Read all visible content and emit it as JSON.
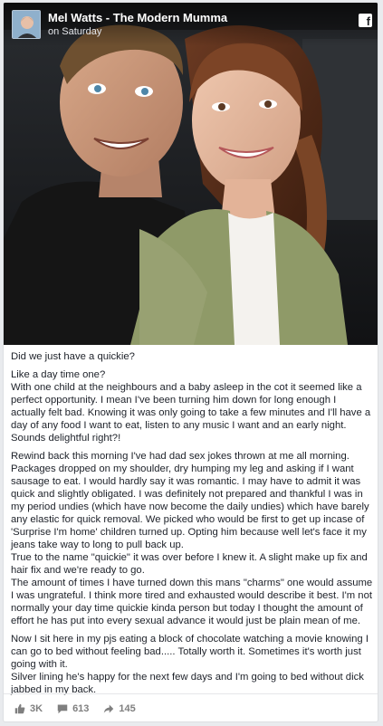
{
  "header": {
    "page_name": "Mel Watts - The Modern Mumma",
    "time": "on Saturday",
    "facebook_glyph": "f"
  },
  "post": {
    "paragraphs": [
      "Did we just have a quickie?",
      "Like a day time one?\nWith one child at the neighbours and a baby asleep in the cot it seemed like a perfect opportunity. I mean I've been turning him down for long enough I actually felt bad. Knowing it was only going to take a few minutes and I'll have a day of any food I want to eat, listen to any music I want and an early night. Sounds delightful right?!",
      "Rewind back this morning I've had dad sex jokes thrown at me all morning. Packages dropped on my shoulder, dry humping my leg and asking if I want sausage to eat. I would hardly say it was romantic. I may have to admit it was quick and slightly obligated. I was definitely not prepared and thankful I was in my period undies (which have now become the daily undies) which have barely any elastic for quick removal. We picked who would be first to get up incase of 'Surprise I'm home' children turned up. Opting him because well let's face it my jeans take way to long to pull back up.\nTrue to the name \"quickie\" it was over before I knew it. A slight make up fix and hair fix and we're ready to go.\nThe amount of times I have turned down this mans \"charms\" one would assume I was ungrateful. I think more tired and exhausted would describe it best. I'm not normally your day time quickie kinda person but today I thought the amount of effort he has put into every sexual advance it would just be plain mean of me.",
      "Now I sit here in my pjs eating a block of chocolate watching a movie knowing I can go to bed without feeling bad..... Totally worth it. Sometimes it's worth just going with it.\nSilver lining he's happy for the next few days and I'm going to bed without dick jabbed in my back."
    ]
  },
  "footer": {
    "likes": "3K",
    "comments": "613",
    "shares": "145",
    "icons": [
      "thumbs-up-icon",
      "comment-icon",
      "share-icon"
    ],
    "icon_color": "#7f7f7f"
  }
}
